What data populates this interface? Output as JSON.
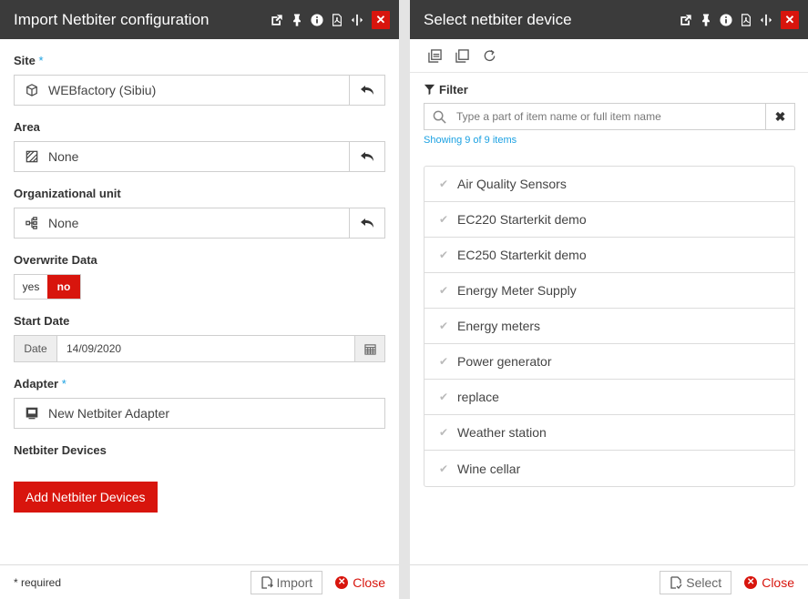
{
  "left": {
    "title": "Import Netbiter configuration",
    "fields": {
      "site": {
        "label": "Site",
        "required_mark": "*",
        "value": "WEBfactory (Sibiu)"
      },
      "area": {
        "label": "Area",
        "value": "None"
      },
      "org_unit": {
        "label": "Organizational unit",
        "value": "None"
      },
      "overwrite": {
        "label": "Overwrite Data",
        "yes": "yes",
        "no": "no",
        "selected": "no"
      },
      "start_date": {
        "label": "Start Date",
        "addon": "Date",
        "value": "14/09/2020"
      },
      "adapter": {
        "label": "Adapter",
        "required_mark": "*",
        "value": "New Netbiter Adapter"
      },
      "devices": {
        "label": "Netbiter Devices",
        "button": "Add Netbiter Devices"
      }
    },
    "footer": {
      "note": "* required",
      "import": "Import",
      "close": "Close"
    }
  },
  "right": {
    "title": "Select netbiter device",
    "filter_label": "Filter",
    "search_placeholder": "Type a part of item name or full item name",
    "showing": "Showing 9 of 9 items",
    "items": [
      "Air Quality Sensors",
      "EC220 Starterkit demo",
      "EC250 Starterkit demo",
      "Energy Meter Supply",
      "Energy meters",
      "Power generator",
      "replace",
      "Weather station",
      "Wine cellar"
    ],
    "footer": {
      "select": "Select",
      "close": "Close"
    }
  },
  "colors": {
    "accent": "#d8150d",
    "titlebar": "#3b3b3b",
    "link": "#1ba1e2"
  }
}
